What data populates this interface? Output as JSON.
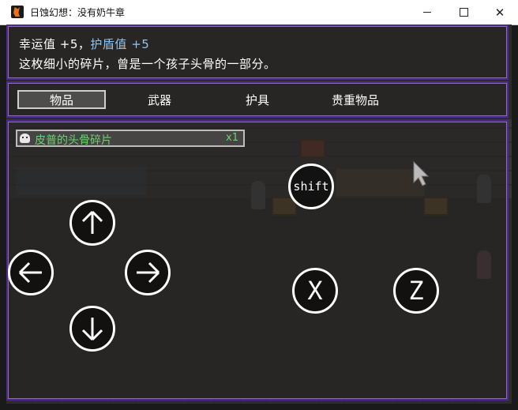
{
  "window": {
    "title": "日蚀幻想：没有奶牛章",
    "controls": {
      "minimize": "–",
      "maximize": "□",
      "close": "✕"
    }
  },
  "help": {
    "luck_label": "幸运值",
    "luck_value": "+5，",
    "shield_label": "护盾值",
    "shield_value": "+5",
    "description": "这枚细小的碎片，曾是一个孩子头骨的一部分。"
  },
  "categories": [
    {
      "label": "物品",
      "selected": true
    },
    {
      "label": "武器",
      "selected": false
    },
    {
      "label": "护具",
      "selected": false
    },
    {
      "label": "贵重物品",
      "selected": false
    }
  ],
  "items": [
    {
      "icon": "skull-icon",
      "name": "皮普的头骨碎片",
      "qty": "x1"
    }
  ],
  "touch_controls": {
    "shift": "shift",
    "x": "X",
    "z": "Z",
    "up": "arrow-up-icon",
    "down": "arrow-down-icon",
    "left": "arrow-left-icon",
    "right": "arrow-right-icon"
  },
  "colors": {
    "panel_border": "#4a2a8c",
    "highlight_text": "#8ec5f0",
    "item_text": "#6fcf6f"
  }
}
